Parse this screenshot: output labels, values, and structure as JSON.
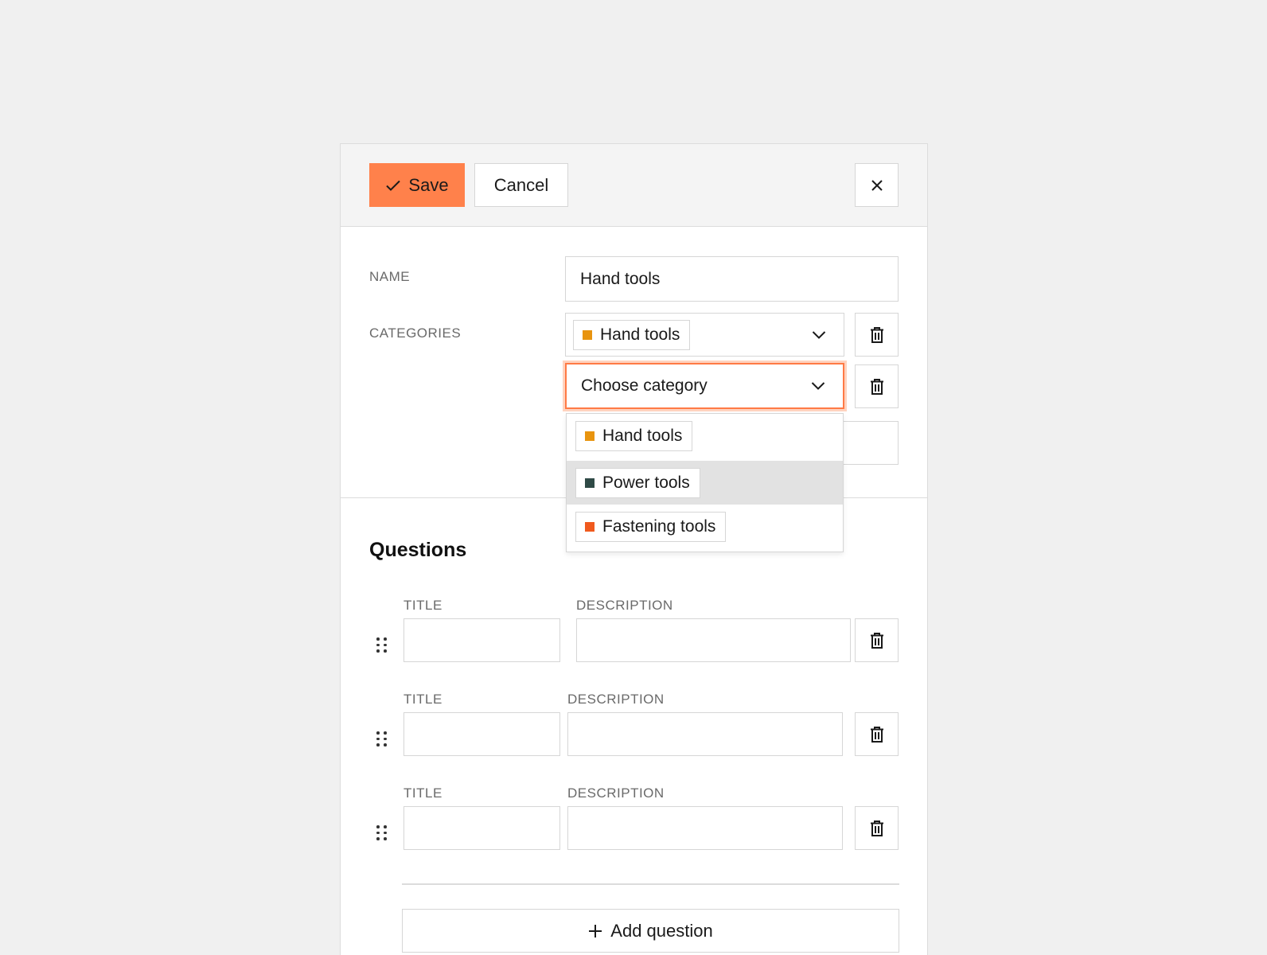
{
  "toolbar": {
    "save_label": "Save",
    "cancel_label": "Cancel"
  },
  "form": {
    "name_label": "NAME",
    "name_value": "Hand tools",
    "categories_label": "CATEGORIES",
    "selected_category": {
      "label": "Hand tools",
      "color": "#e8940f"
    },
    "choose_placeholder": "Choose category"
  },
  "dropdown": {
    "options": [
      {
        "label": "Hand tools",
        "color": "#e8940f",
        "highlighted": false
      },
      {
        "label": "Power tools",
        "color": "#2f4a46",
        "highlighted": true
      },
      {
        "label": "Fastening tools",
        "color": "#f05a1e",
        "highlighted": false
      }
    ]
  },
  "questions": {
    "title": "Questions",
    "rows": [
      {
        "title_label": "TITLE",
        "description_label": "DESCRIPTION",
        "title_value": "",
        "description_value": ""
      },
      {
        "title_label": "TITLE",
        "description_label": "DESCRIPTION",
        "title_value": "",
        "description_value": ""
      },
      {
        "title_label": "TITLE",
        "description_label": "DESCRIPTION",
        "title_value": "",
        "description_value": ""
      }
    ],
    "add_label": "Add question"
  },
  "colors": {
    "accent": "#ff814b",
    "focus_ring": "#ff7a45"
  },
  "icons": [
    "check-icon",
    "close-icon",
    "chevron-down-icon",
    "trash-icon",
    "drag-handle-icon",
    "plus-icon"
  ]
}
